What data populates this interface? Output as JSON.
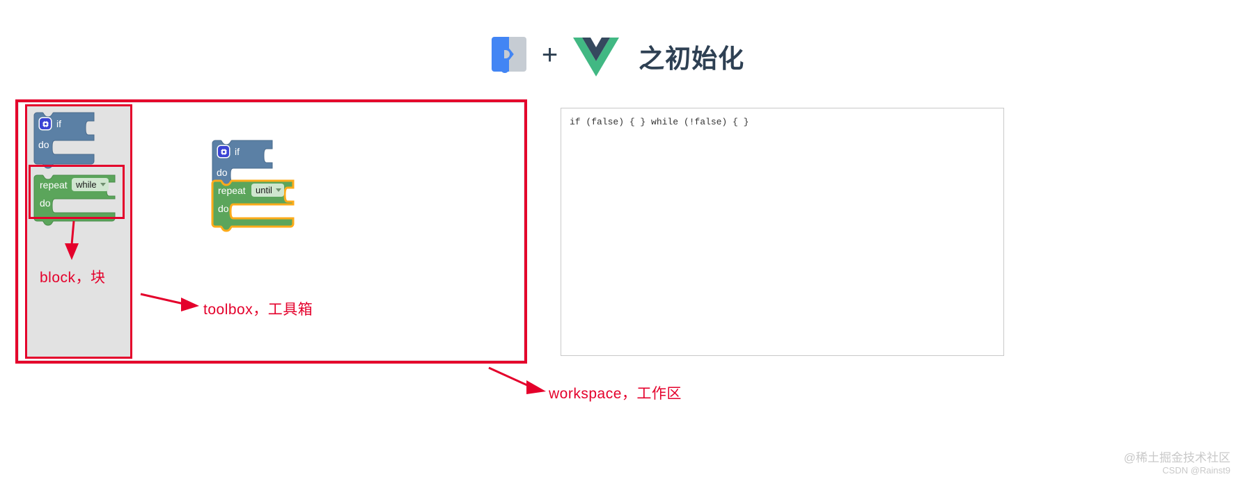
{
  "header": {
    "blockly_logo_name": "blockly-logo",
    "plus": "+",
    "vue_logo_name": "vue-logo",
    "title": "之初始化"
  },
  "toolbox": {
    "blocks": [
      {
        "id": "if-block",
        "gear": "gear-icon",
        "label_if": "if",
        "label_do": "do",
        "color": "#5b80a5"
      },
      {
        "id": "repeat-while-block",
        "label_repeat": "repeat",
        "dropdown_value": "while",
        "label_do": "do",
        "color": "#5ba55b"
      }
    ]
  },
  "workspace": {
    "blocks": [
      {
        "id": "if-block",
        "gear": "gear-icon",
        "label_if": "if",
        "label_do": "do",
        "color": "#5b80a5"
      },
      {
        "id": "repeat-until-block",
        "label_repeat": "repeat",
        "dropdown_value": "until",
        "label_do": "do",
        "color": "#5ba55b",
        "selected_outline": "#fcab1a"
      }
    ]
  },
  "code_panel": {
    "code": "if (false) { } while (!false) { }"
  },
  "annotations": {
    "block_label": "block，块",
    "toolbox_label": "toolbox，工具箱",
    "workspace_label": "workspace，工作区",
    "highlight_color": "#e4002b"
  },
  "watermark": {
    "line1": "@稀土掘金技术社区",
    "line2": "CSDN @Rainst9"
  }
}
